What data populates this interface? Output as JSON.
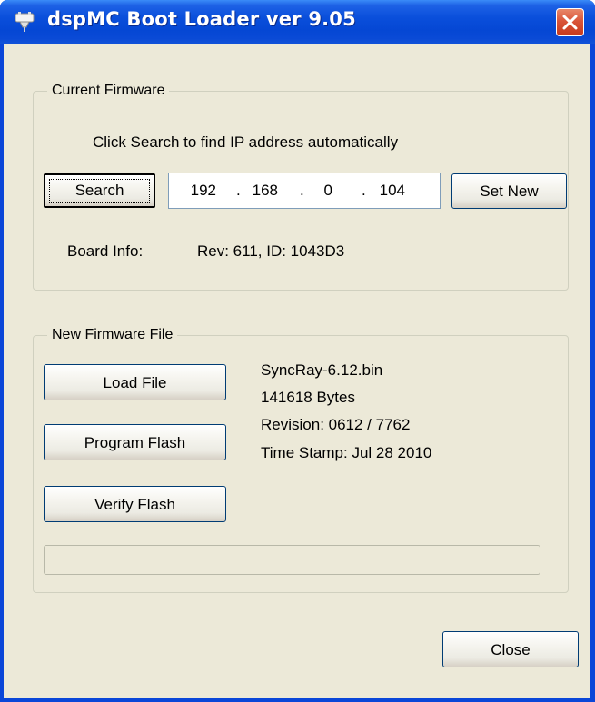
{
  "window": {
    "title": "dspMC Boot Loader ver 9.05",
    "icons": {
      "app": "plug-icon",
      "close": "close-icon"
    },
    "colors": {
      "titlebar": "#0a4fdb",
      "client": "#ece9d8",
      "close": "#d9553a"
    }
  },
  "current_firmware": {
    "group_label": "Current Firmware",
    "hint": "Click Search to find IP address automatically",
    "search_label": "Search",
    "ip": {
      "octet1": "192",
      "octet2": "168",
      "octet3": "0",
      "octet4": "104",
      "separator": "."
    },
    "set_new_label": "Set New",
    "board_info_label": "Board Info:",
    "board_info_value": "Rev: 611, ID: 1043D3"
  },
  "new_firmware": {
    "group_label": "New Firmware File",
    "load_label": "Load File",
    "program_label": "Program Flash",
    "verify_label": "Verify Flash",
    "file_name": "SyncRay-6.12.bin",
    "file_size": "141618 Bytes",
    "revision": "Revision: 0612 / 7762",
    "time_stamp": "Time Stamp: Jul 28 2010",
    "progress": 0
  },
  "close_label": "Close"
}
